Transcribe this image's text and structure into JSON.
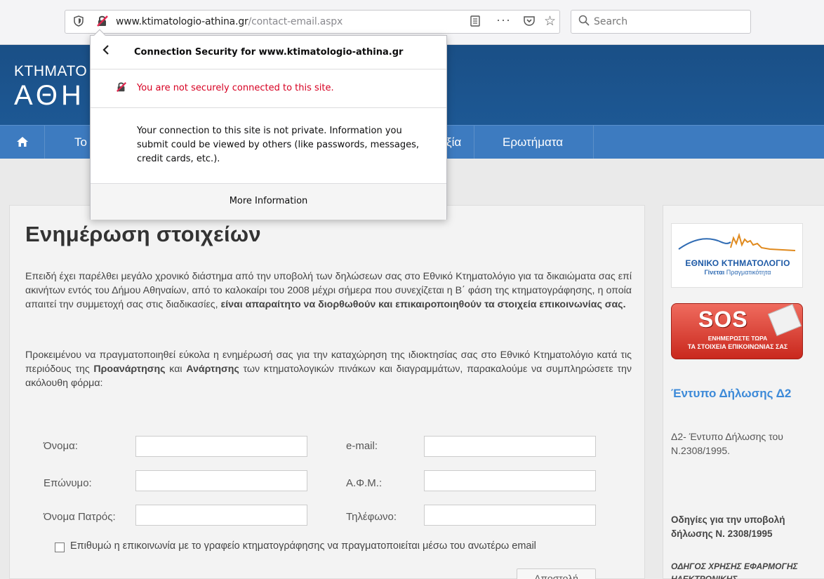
{
  "browser": {
    "url_domain": "www.ktimatologio-athina.gr",
    "url_path": "/contact-email.aspx",
    "search_placeholder": "Search",
    "icons": [
      "shield-icon",
      "insecure-lock-icon",
      "reader-view-icon",
      "more-icon",
      "pocket-icon",
      "bookmark-star-icon",
      "search-icon"
    ]
  },
  "header": {
    "logo_line1": "ΚΤΗΜΑΤΟ",
    "logo_line2": "ΑΘΗ"
  },
  "nav": {
    "home_icon": "home-icon",
    "items": [
      "Το",
      "ξία",
      "Ερωτήματα"
    ]
  },
  "main": {
    "title": "Ενημέρωση στοιχείων",
    "p1_start": "Επειδή έχει παρέλθει μεγάλο χρονικό διάστημα από την υποβολή των δηλώσεων σας στο Εθνικό Κτηματολόγιο για τα δικαιώματα σας επί ακινήτων εντός του Δήμου Αθηναίων, από το καλοκαίρι του 2008 μέχρι σήμερα που συνεχίζεται η Β΄ φάση της κτηματογράφησης, η οποία απαιτεί την συμμετοχή σας στις διαδικασίες, ",
    "p1_bold": "είναι απαραίτητο να διορθωθούν και επικαιροποιηθούν τα στοιχεία επικοινωνίας σας.",
    "p2_a": "Προκειμένου να πραγματοποιηθεί εύκολα η ενημέρωσή σας για την καταχώρηση της ιδιοκτησίας σας στο Εθνικό Κτηματολόγιο κατά τις περιόδους της ",
    "p2_bold1": "Προανάρτησης",
    "p2_b": " και ",
    "p2_bold2": "Ανάρτησης",
    "p2_c": " των κτηματολογικών πινάκων και διαγραμμάτων, παρακαλούμε να συμπληρώσετε την ακόλουθη φόρμα:"
  },
  "form": {
    "first_name_label": "Όνομα:",
    "last_name_label": "Επώνυμο:",
    "father_name_label": "Όνομα Πατρός:",
    "email_label": "e-mail:",
    "afm_label": "Α.Φ.Μ.:",
    "phone_label": "Τηλέφωνο:",
    "first_name_value": "",
    "last_name_value": "",
    "father_name_value": "",
    "email_value": "",
    "afm_value": "",
    "phone_value": "",
    "checkbox_label": "Επιθυμώ η επικοινωνία με το γραφείο κτηματογράφησης να πραγματοποιείται μέσω του ανωτέρω email",
    "checkbox_checked": false,
    "submit_label": "Αποστολή"
  },
  "sidebar": {
    "banner1_title": "ΕΘΝΙΚΟ ΚΤΗΜΑΤΟΛΟΓΙΟ",
    "banner1_sub_bold": "Γίνεται",
    "banner1_sub": " Πραγματικότητα",
    "banner2_sos": "SOS",
    "banner2_line1": "ΕΝΗΜΕΡΩΣΤΕ ΤΩΡΑ",
    "banner2_line2": "ΤΑ ΣΤΟΙΧΕΙΑ ΕΠΙΚΟΙΝΩΝΙΑΣ ΣΑΣ",
    "heading": "Έντυπο Δήλωσης Δ2",
    "link_text": "Δ2- Έντυπο Δήλωσης του Ν.2308/1995.",
    "bold_text": "Οδηγίες για την υποβολή δήλωσης Ν. 2308/1995",
    "italic_text": "ΟΔΗΓΟΣ ΧΡΗΣΗΣ ΕΦΑΡΜΟΓΗΣ ΗΛΕΚΤΡΟΝΙΚΗΣ"
  },
  "popup": {
    "title": "Connection Security for www.ktimatologio-athina.gr",
    "warning": "You are not securely connected to this site.",
    "body": "Your connection to this site is not private. Information you submit could be viewed by others (like passwords, messages, credit cards, etc.).",
    "more_info": "More Information"
  },
  "colors": {
    "header_blue": "#1d5894",
    "nav_blue": "#3d7bc0",
    "warning_red": "#d70022",
    "link_blue": "#3d8ad8",
    "sos_red": "#d63a2e"
  }
}
